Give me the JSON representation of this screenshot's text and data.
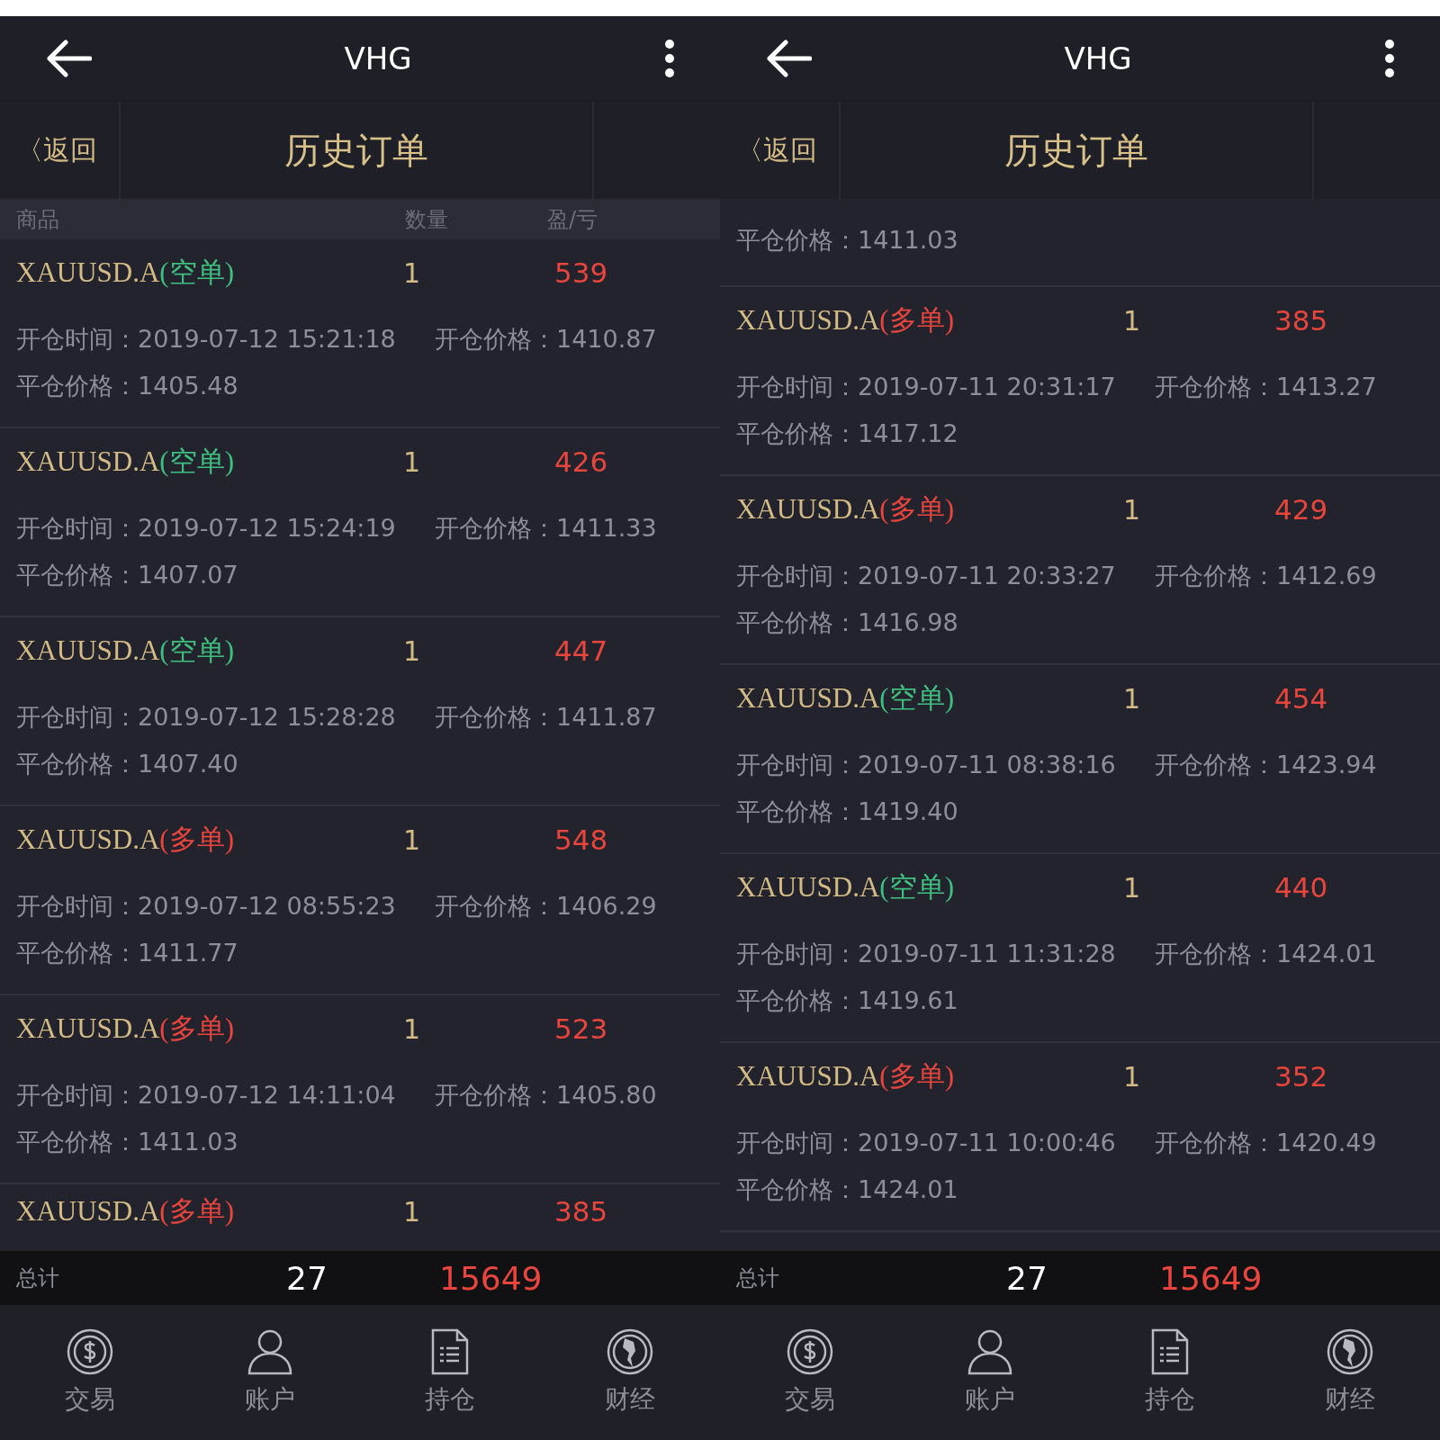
{
  "panels": [
    {
      "app_bar": {
        "title": "VHG"
      },
      "title_bar": {
        "back": "〈返回",
        "title": "历史订单"
      },
      "columns": [
        "商品",
        "数量",
        "盈/亏"
      ],
      "orders": [
        {
          "symbol": "XAUUSD.A",
          "side": "(空单)",
          "kind": "short",
          "qty": "1",
          "profit": "539",
          "open_time": "开仓时间：2019-07-12 15:21:18",
          "open_price": "开仓价格：1410.87",
          "close_price": "平仓价格：1405.48"
        },
        {
          "symbol": "XAUUSD.A",
          "side": "(空单)",
          "kind": "short",
          "qty": "1",
          "profit": "426",
          "open_time": "开仓时间：2019-07-12 15:24:19",
          "open_price": "开仓价格：1411.33",
          "close_price": "平仓价格：1407.07"
        },
        {
          "symbol": "XAUUSD.A",
          "side": "(空单)",
          "kind": "short",
          "qty": "1",
          "profit": "447",
          "open_time": "开仓时间：2019-07-12 15:28:28",
          "open_price": "开仓价格：1411.87",
          "close_price": "平仓价格：1407.40"
        },
        {
          "symbol": "XAUUSD.A",
          "side": "(多单)",
          "kind": "long",
          "qty": "1",
          "profit": "548",
          "open_time": "开仓时间：2019-07-12 08:55:23",
          "open_price": "开仓价格：1406.29",
          "close_price": "平仓价格：1411.77"
        },
        {
          "symbol": "XAUUSD.A",
          "side": "(多单)",
          "kind": "long",
          "qty": "1",
          "profit": "523",
          "open_time": "开仓时间：2019-07-12 14:11:04",
          "open_price": "开仓价格：1405.80",
          "close_price": "平仓价格：1411.03"
        },
        {
          "symbol": "XAUUSD.A",
          "side": "(多单)",
          "kind": "long",
          "qty": "1",
          "profit": "385"
        }
      ],
      "total": {
        "label": "总计",
        "count": "27",
        "profit": "15649"
      },
      "tabs": [
        {
          "label": "交易"
        },
        {
          "label": "账户"
        },
        {
          "label": "持仓"
        },
        {
          "label": "财经"
        }
      ]
    },
    {
      "app_bar": {
        "title": "VHG"
      },
      "title_bar": {
        "back": "〈返回",
        "title": "历史订单"
      },
      "orders": [
        {
          "close_price": "平仓价格：1411.03"
        },
        {
          "symbol": "XAUUSD.A",
          "side": "(多单)",
          "kind": "long",
          "qty": "1",
          "profit": "385",
          "open_time": "开仓时间：2019-07-11 20:31:17",
          "open_price": "开仓价格：1413.27",
          "close_price": "平仓价格：1417.12"
        },
        {
          "symbol": "XAUUSD.A",
          "side": "(多单)",
          "kind": "long",
          "qty": "1",
          "profit": "429",
          "open_time": "开仓时间：2019-07-11 20:33:27",
          "open_price": "开仓价格：1412.69",
          "close_price": "平仓价格：1416.98"
        },
        {
          "symbol": "XAUUSD.A",
          "side": "(空单)",
          "kind": "short",
          "qty": "1",
          "profit": "454",
          "open_time": "开仓时间：2019-07-11 08:38:16",
          "open_price": "开仓价格：1423.94",
          "close_price": "平仓价格：1419.40"
        },
        {
          "symbol": "XAUUSD.A",
          "side": "(空单)",
          "kind": "short",
          "qty": "1",
          "profit": "440",
          "open_time": "开仓时间：2019-07-11 11:31:28",
          "open_price": "开仓价格：1424.01",
          "close_price": "平仓价格：1419.61"
        },
        {
          "symbol": "XAUUSD.A",
          "side": "(多单)",
          "kind": "long",
          "qty": "1",
          "profit": "352",
          "open_time": "开仓时间：2019-07-11 10:00:46",
          "open_price": "开仓价格：1420.49",
          "close_price": "平仓价格：1424.01"
        }
      ],
      "total": {
        "label": "总计",
        "count": "27",
        "profit": "15649"
      },
      "tabs": [
        {
          "label": "交易"
        },
        {
          "label": "账户"
        },
        {
          "label": "持仓"
        },
        {
          "label": "财经"
        }
      ]
    }
  ]
}
